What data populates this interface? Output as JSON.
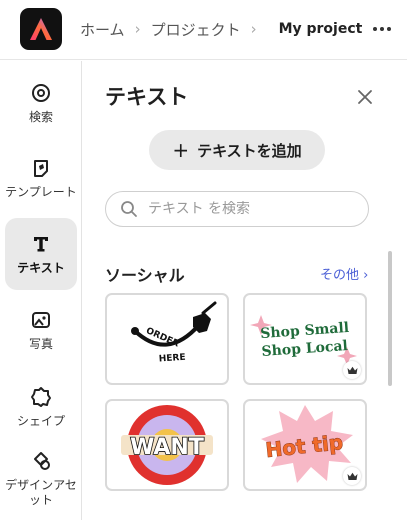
{
  "header": {
    "logo_icon": "adobe-express-logo",
    "breadcrumbs": [
      "ホーム",
      "プロジェクト"
    ],
    "current": "My project",
    "more_icon": "more-horizontal-icon"
  },
  "rail": {
    "items": [
      {
        "label": "検索",
        "icon": "search-compass-icon",
        "active": false
      },
      {
        "label": "テンプレート",
        "icon": "template-icon",
        "active": false
      },
      {
        "label": "テキスト",
        "icon": "text-T-icon",
        "active": true
      },
      {
        "label": "写真",
        "icon": "photo-icon",
        "active": false
      },
      {
        "label": "シェイプ",
        "icon": "shape-icon",
        "active": false
      },
      {
        "label": "デザインアセット",
        "label_lines": [
          "デザインアセ",
          "ット"
        ],
        "icon": "design-assets-icon",
        "active": false
      }
    ]
  },
  "panel": {
    "title": "テキスト",
    "add_button": "テキストを追加",
    "search_placeholder": "テキスト を検索",
    "section": {
      "title": "ソーシャル",
      "see_all": "その他 ›"
    },
    "cards": [
      {
        "text_lines": [
          "ORDER",
          "HERE"
        ],
        "premium": false
      },
      {
        "text_lines": [
          "Shop Small",
          "Shop Local"
        ],
        "premium": true
      },
      {
        "text_lines": [
          "WANT"
        ],
        "premium": true
      },
      {
        "text_lines": [
          "Hot tip"
        ],
        "premium": true
      }
    ]
  },
  "colors": {
    "accent_link": "#4b5fd6",
    "shop_green": "#1f6b3a",
    "shop_pink": "#f2a7b8",
    "hot_orange": "#f06a2a",
    "hot_pink": "#f7b8c6",
    "want_red": "#e0312e",
    "want_lilac": "#c9b6ee"
  }
}
